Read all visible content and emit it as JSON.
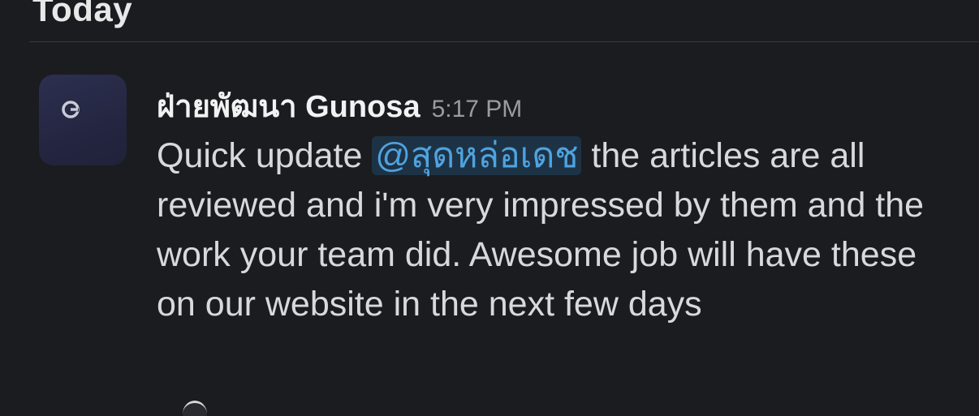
{
  "day_header": "Today",
  "message": {
    "sender": "ฝ่ายพัฒนา Gunosa",
    "time": "5:17 PM",
    "text_before_mention": "Quick update ",
    "mention": "@สุดหล่อเดช",
    "text_after_mention": " the articles are all reviewed and i'm very impressed by them and the work your team did. Awesome job will have these on our website in the next few days"
  },
  "colors": {
    "background": "#1b1c20",
    "mention_text": "#4fa3e0",
    "mention_bg": "#1d3345"
  }
}
